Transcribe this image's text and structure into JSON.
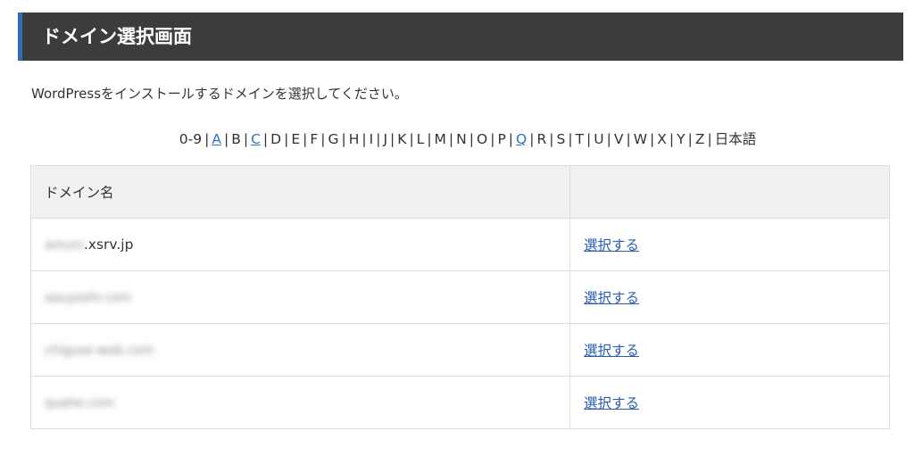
{
  "header": {
    "title": "ドメイン選択画面",
    "accent_color": "#2f6db5",
    "bg_color": "#3c3c3c"
  },
  "instruction": "WordPressをインストールするドメインを選択してください。",
  "alpha_nav": [
    {
      "label": "0-9",
      "link": false
    },
    {
      "label": "A",
      "link": true
    },
    {
      "label": "B",
      "link": false
    },
    {
      "label": "C",
      "link": true
    },
    {
      "label": "D",
      "link": false
    },
    {
      "label": "E",
      "link": false
    },
    {
      "label": "F",
      "link": false
    },
    {
      "label": "G",
      "link": false
    },
    {
      "label": "H",
      "link": false
    },
    {
      "label": "I",
      "link": false
    },
    {
      "label": "J",
      "link": false
    },
    {
      "label": "K",
      "link": false
    },
    {
      "label": "L",
      "link": false
    },
    {
      "label": "M",
      "link": false
    },
    {
      "label": "N",
      "link": false
    },
    {
      "label": "O",
      "link": false
    },
    {
      "label": "P",
      "link": false
    },
    {
      "label": "Q",
      "link": true
    },
    {
      "label": "R",
      "link": false
    },
    {
      "label": "S",
      "link": false
    },
    {
      "label": "T",
      "link": false
    },
    {
      "label": "U",
      "link": false
    },
    {
      "label": "V",
      "link": false
    },
    {
      "label": "W",
      "link": false
    },
    {
      "label": "X",
      "link": false
    },
    {
      "label": "Y",
      "link": false
    },
    {
      "label": "Z",
      "link": false
    },
    {
      "label": "日本語",
      "link": false
    }
  ],
  "alpha_separator": "|",
  "table": {
    "columns": [
      "ドメイン名",
      ""
    ],
    "rows": [
      {
        "blurred": "amuni",
        "visible": ".xsrv.jp",
        "action": "選択する"
      },
      {
        "blurred": "aauyoshi.com",
        "visible": "",
        "action": "選択する"
      },
      {
        "blurred": "chiguse-web.com",
        "visible": "",
        "action": "選択する"
      },
      {
        "blurred": "quahe.com",
        "visible": "",
        "action": "選択する"
      }
    ]
  },
  "link_color": "#2a5db0"
}
